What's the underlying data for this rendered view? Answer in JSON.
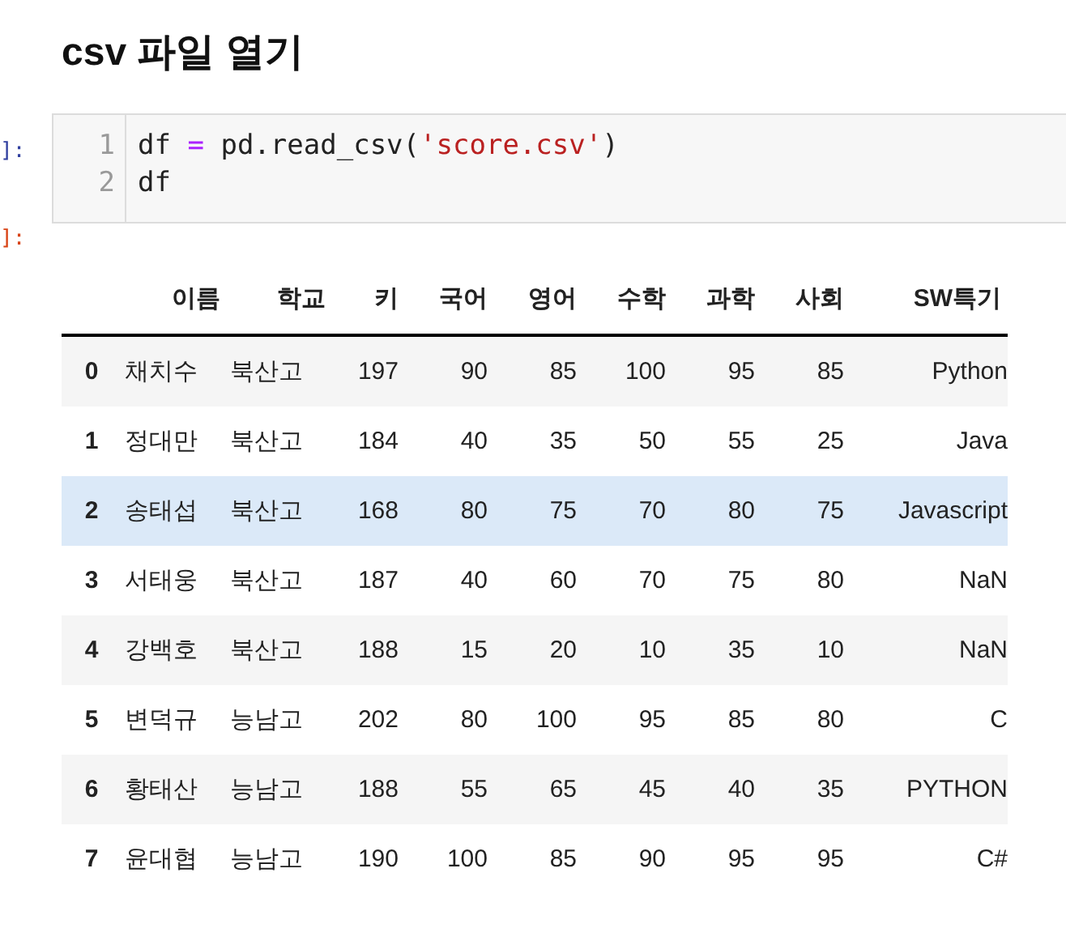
{
  "heading": "csv 파일 열기",
  "input_cell": {
    "prompt": "]:",
    "lines": [
      {
        "number": "1",
        "tokens": [
          {
            "kind": "plain",
            "text": "df "
          },
          {
            "kind": "operator",
            "text": "="
          },
          {
            "kind": "plain",
            "text": " pd.read_csv("
          },
          {
            "kind": "string",
            "text": "'score.csv'"
          },
          {
            "kind": "plain",
            "text": ")"
          }
        ]
      },
      {
        "number": "2",
        "tokens": [
          {
            "kind": "plain",
            "text": "df"
          }
        ]
      }
    ]
  },
  "output_cell": {
    "prompt": "]:",
    "table": {
      "columns": [
        "",
        "이름",
        "학교",
        "키",
        "국어",
        "영어",
        "수학",
        "과학",
        "사회",
        "SW특기"
      ],
      "rows": [
        {
          "hovered": false,
          "cells": [
            "0",
            "채치수",
            "북산고",
            "197",
            "90",
            "85",
            "100",
            "95",
            "85",
            "Python"
          ]
        },
        {
          "hovered": false,
          "cells": [
            "1",
            "정대만",
            "북산고",
            "184",
            "40",
            "35",
            "50",
            "55",
            "25",
            "Java"
          ]
        },
        {
          "hovered": true,
          "cells": [
            "2",
            "송태섭",
            "북산고",
            "168",
            "80",
            "75",
            "70",
            "80",
            "75",
            "Javascript"
          ]
        },
        {
          "hovered": false,
          "cells": [
            "3",
            "서태웅",
            "북산고",
            "187",
            "40",
            "60",
            "70",
            "75",
            "80",
            "NaN"
          ]
        },
        {
          "hovered": false,
          "cells": [
            "4",
            "강백호",
            "북산고",
            "188",
            "15",
            "20",
            "10",
            "35",
            "10",
            "NaN"
          ]
        },
        {
          "hovered": false,
          "cells": [
            "5",
            "변덕규",
            "능남고",
            "202",
            "80",
            "100",
            "95",
            "85",
            "80",
            "C"
          ]
        },
        {
          "hovered": false,
          "cells": [
            "6",
            "황태산",
            "능남고",
            "188",
            "55",
            "65",
            "45",
            "40",
            "35",
            "PYTHON"
          ]
        },
        {
          "hovered": false,
          "cells": [
            "7",
            "윤대협",
            "능남고",
            "190",
            "100",
            "85",
            "90",
            "95",
            "95",
            "C#"
          ]
        }
      ]
    }
  }
}
